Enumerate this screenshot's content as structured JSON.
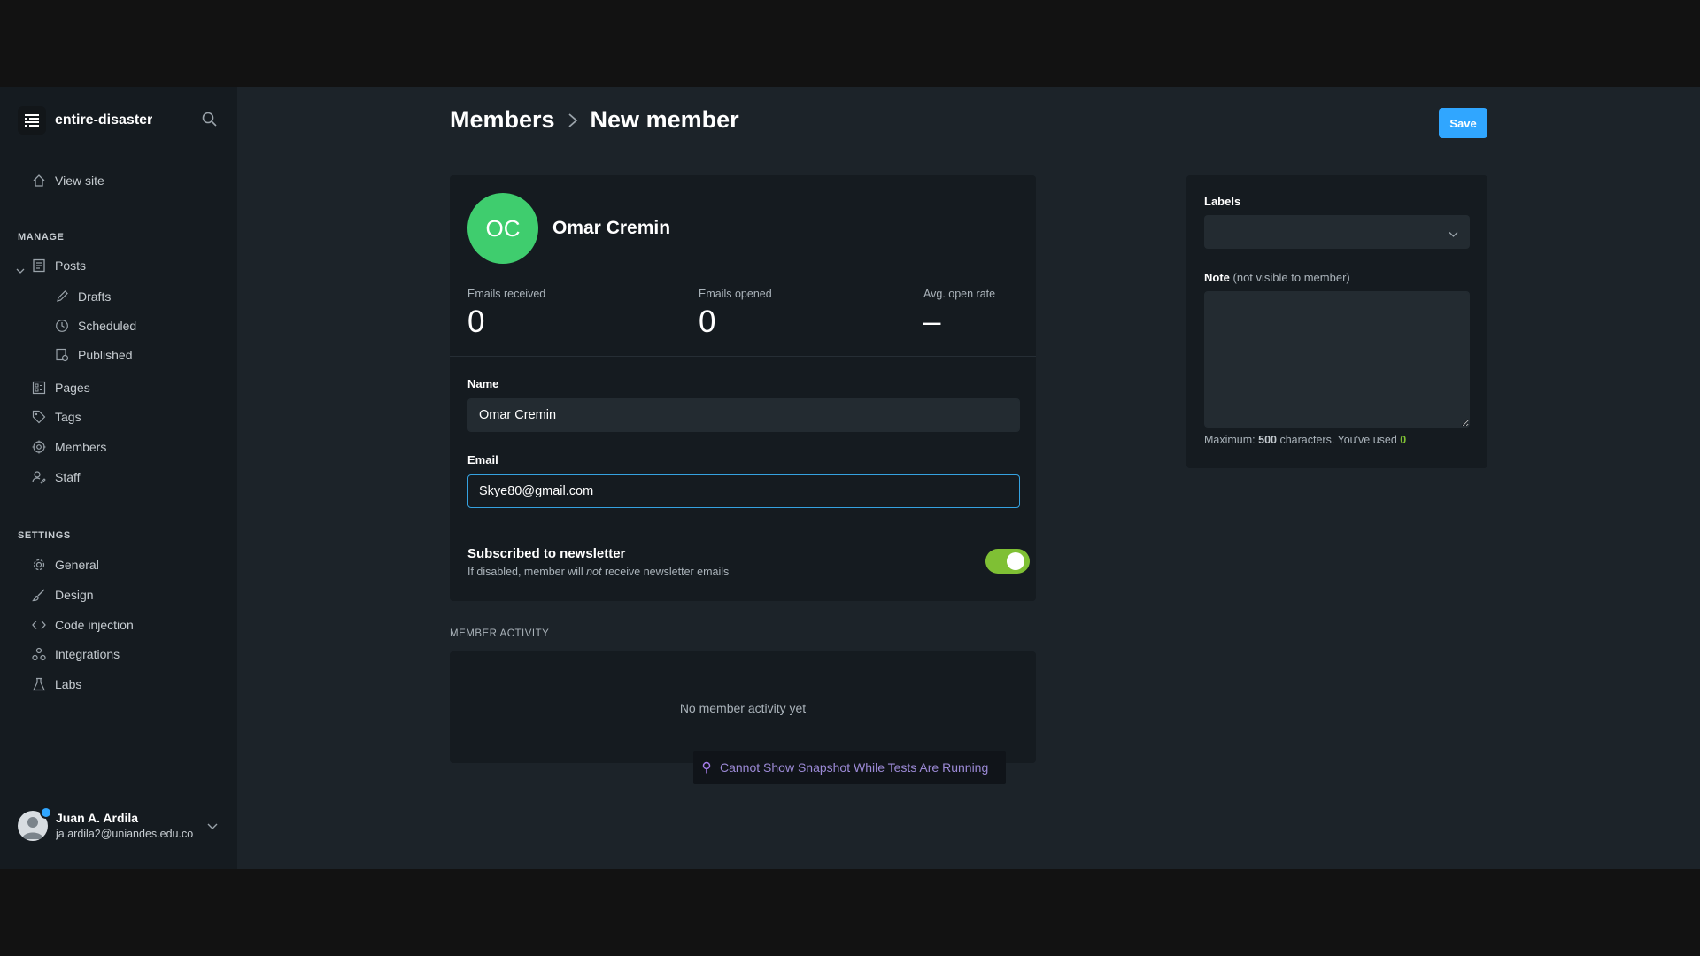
{
  "sidebar": {
    "site_name": "entire-disaster",
    "view_site": "View site",
    "manage_label": "MANAGE",
    "posts": "Posts",
    "drafts": "Drafts",
    "scheduled": "Scheduled",
    "published": "Published",
    "pages": "Pages",
    "tags": "Tags",
    "members": "Members",
    "staff": "Staff",
    "settings_label": "SETTINGS",
    "general": "General",
    "design": "Design",
    "code_injection": "Code injection",
    "integrations": "Integrations",
    "labs": "Labs",
    "user": {
      "name": "Juan A. Ardila",
      "email": "ja.ardila2@uniandes.edu.co"
    }
  },
  "header": {
    "breadcrumb_parent": "Members",
    "breadcrumb_current": "New member",
    "save_label": "Save"
  },
  "member": {
    "initials": "OC",
    "name": "Omar Cremin",
    "stats": {
      "emails_received_label": "Emails received",
      "emails_received": "0",
      "emails_opened_label": "Emails opened",
      "emails_opened": "0",
      "avg_open_rate_label": "Avg. open rate",
      "avg_open_rate": "–"
    },
    "name_label": "Name",
    "name_value": "Omar Cremin",
    "email_label": "Email",
    "email_value": "Skye80@gmail.com",
    "newsletter_title": "Subscribed to newsletter",
    "newsletter_sub_prefix": "If disabled, member will ",
    "newsletter_sub_em": "not",
    "newsletter_sub_suffix": " receive newsletter emails",
    "newsletter_enabled": true
  },
  "activity": {
    "label": "MEMBER ACTIVITY",
    "empty": "No member activity yet",
    "snapshot_notice": "Cannot Show Snapshot While Tests Are Running"
  },
  "side": {
    "labels_label": "Labels",
    "labels_value": "",
    "note_label": "Note",
    "note_hint_label": "(not visible to member)",
    "note_value": "",
    "limit_prefix": "Maximum: ",
    "limit_max": "500",
    "limit_mid": " characters. You've used ",
    "limit_used": "0"
  },
  "colors": {
    "accent": "#30a6ff",
    "avatar_green": "#3fcd6e",
    "toggle_green": "#7fc034",
    "focus_border": "#35a2e0"
  }
}
